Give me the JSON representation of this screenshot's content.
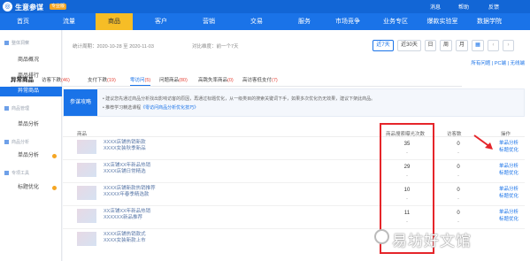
{
  "header": {
    "brand": "生意参谋",
    "badge": "专业版",
    "links": [
      "消息",
      "帮助",
      "反馈"
    ]
  },
  "nav": {
    "items": [
      "首页",
      "流量",
      "商品",
      "客户",
      "营销",
      "交易",
      "服务",
      "市场竞争",
      "业务专区",
      "爆款实验室",
      "数据学院"
    ],
    "active_index": 2
  },
  "sidebar": {
    "groups": [
      {
        "label": "整体洞察",
        "items": [
          {
            "label": "商品概况"
          },
          {
            "label": "商品排行"
          },
          {
            "label": "异常商品",
            "active": true
          }
        ]
      },
      {
        "label": "商品管理",
        "items": [
          {
            "label": "单品分析"
          }
        ]
      },
      {
        "label": "商品分析",
        "items": [
          {
            "label": "单品分析",
            "badge": true
          }
        ]
      },
      {
        "label": "专项工具",
        "items": [
          {
            "label": "标题优化",
            "badge": true
          }
        ]
      }
    ]
  },
  "filters": {
    "stat_period": "统计周期：2020-10-28 至 2020-11-03",
    "compare": "对比维度：前一个7天",
    "buttons": [
      "近7天",
      "近30天",
      "日",
      "周",
      "月"
    ],
    "selected": "近7天",
    "links": "所有问题 | PC端 | 无线端"
  },
  "tabs": {
    "first": "异常商品",
    "items": [
      {
        "label": "访客下跌",
        "count": "(46)"
      },
      {
        "label": "支付下跌",
        "count": "(19)"
      },
      {
        "label": "零访问",
        "count": "(5)",
        "active": true
      },
      {
        "label": "问题商品",
        "count": "(80)"
      },
      {
        "label": "高跳失率商品",
        "count": "(0)"
      },
      {
        "label": "高访客低支付",
        "count": "(7)"
      }
    ]
  },
  "tip": {
    "badge": "参谋攻略",
    "line1": "• 建议您先通过商品分析找出影响访客的原因，再通过标题优化，从一级类目的搜索关键词下手，如果多次优化仍无效果，建议下架此商品。",
    "line2_prefix": "• 推荐学习精选课程",
    "line2_link": "《零访问商品分析优化技巧》"
  },
  "table": {
    "headers": {
      "product": "商品",
      "search": "商品搜索曝光次数",
      "visitors": "访客数",
      "ops": "操作"
    },
    "rows": [
      {
        "name": "XXXX店铺热销新款\nXXXX女装秋季新品",
        "search": "35",
        "visitors": "0",
        "actions": [
          "单品分析",
          "标题优化"
        ]
      },
      {
        "name": "XX店铺XX年新品热销\nXXXX店铺日常精选",
        "search": "29",
        "visitors": "0",
        "actions": [
          "单品分析",
          "标题优化"
        ]
      },
      {
        "name": "XXXX店铺新款热销推荐\nXXXXX年春季精选款",
        "search": "10",
        "visitors": "0",
        "actions": [
          "单品分析",
          "标题优化"
        ]
      },
      {
        "name": "XX店铺XX年新品热销\nXXXXXX新品推荐",
        "search": "11",
        "visitors": "0",
        "actions": [
          "单品分析",
          "标题优化"
        ]
      },
      {
        "name": "XXXX店铺热销款式\nXXXX女装新款上市",
        "search": "",
        "visitors": "",
        "actions": []
      }
    ],
    "dash": "-"
  },
  "watermark": "易坊好文馆"
}
